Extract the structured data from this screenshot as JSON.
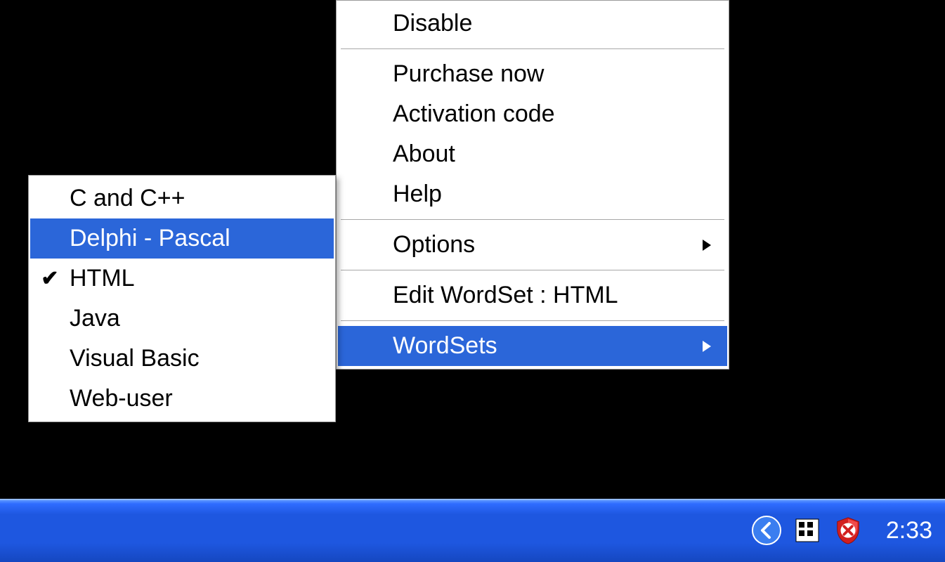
{
  "main_menu": {
    "disable": "Disable",
    "purchase": "Purchase now",
    "activation": "Activation code",
    "about": "About",
    "help": "Help",
    "options": "Options",
    "edit_wordset": "Edit WordSet : HTML",
    "wordsets": "WordSets"
  },
  "sub_menu": {
    "items": [
      {
        "label": "C and C++",
        "checked": false,
        "selected": false
      },
      {
        "label": "Delphi - Pascal",
        "checked": false,
        "selected": true
      },
      {
        "label": "HTML",
        "checked": true,
        "selected": false
      },
      {
        "label": "Java",
        "checked": false,
        "selected": false
      },
      {
        "label": "Visual Basic",
        "checked": false,
        "selected": false
      },
      {
        "label": "Web-user",
        "checked": false,
        "selected": false
      }
    ]
  },
  "taskbar": {
    "clock": "2:33"
  }
}
